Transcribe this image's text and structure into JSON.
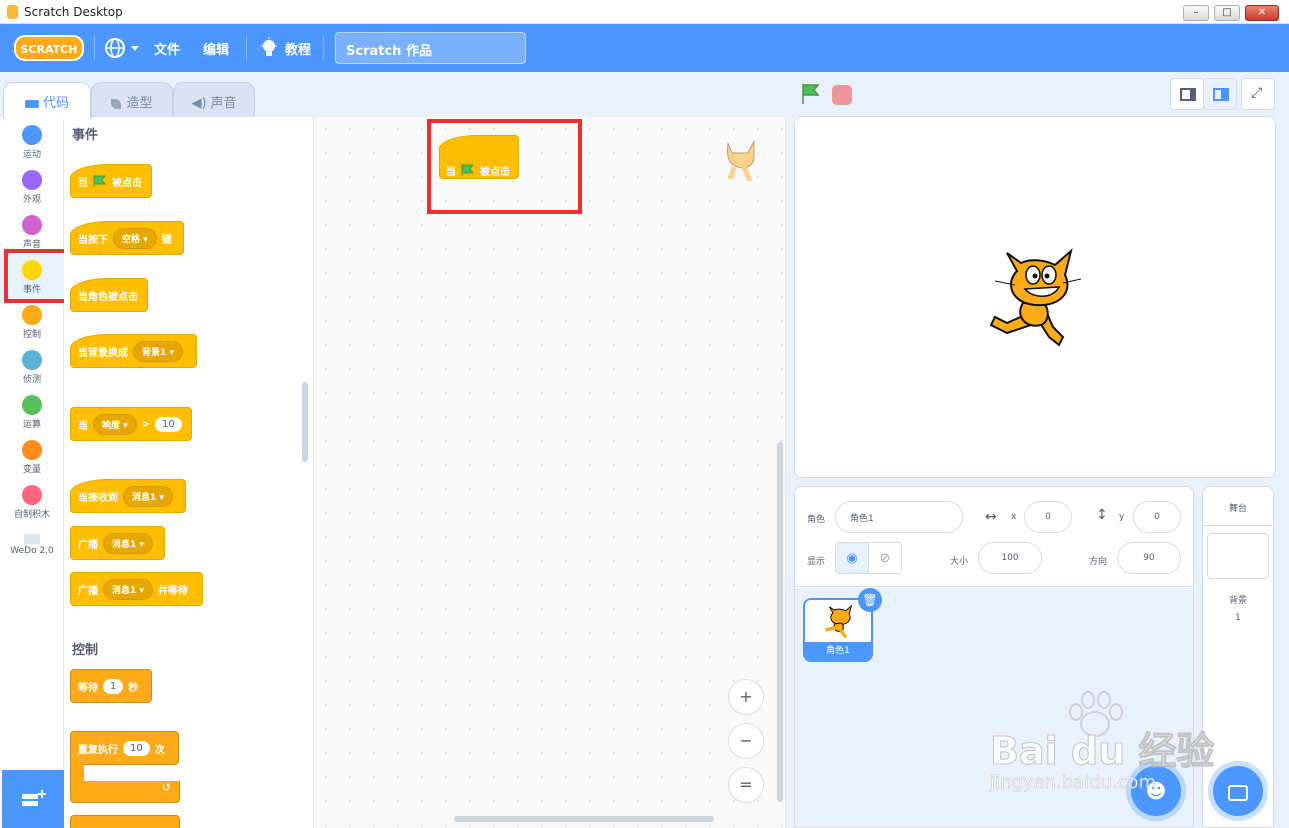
{
  "window": {
    "title": "Scratch Desktop",
    "buttons": [
      "–",
      "□",
      "✕"
    ]
  },
  "menubar": {
    "logo": "SCRATCH",
    "file": "文件",
    "edit": "编辑",
    "tutorials": "教程",
    "project_title": "Scratch 作品"
  },
  "tabs": [
    {
      "label": "代码"
    },
    {
      "label": "造型"
    },
    {
      "label": "声音"
    }
  ],
  "categories": [
    {
      "label": "运动",
      "color": "#4c97ff"
    },
    {
      "label": "外观",
      "color": "#9966ff"
    },
    {
      "label": "声音",
      "color": "#cf63cf"
    },
    {
      "label": "事件",
      "color": "#ffd500"
    },
    {
      "label": "控制",
      "color": "#ffab19"
    },
    {
      "label": "侦测",
      "color": "#5cb1d6"
    },
    {
      "label": "运算",
      "color": "#59c059"
    },
    {
      "label": "变量",
      "color": "#ff8c1a"
    },
    {
      "label": "自制积木",
      "color": "#ff6680"
    },
    {
      "label": "WeDo 2.0",
      "color": ""
    }
  ],
  "palette": {
    "events_header": "事件",
    "when_flag": {
      "pre": "当",
      "post": "被点击"
    },
    "when_key": {
      "pre": "当按下",
      "dropdown": "空格 ▾",
      "post": "键"
    },
    "when_sprite_clicked": "当角色被点击",
    "when_backdrop": {
      "pre": "当背景换成",
      "dropdown": "背景1 ▾"
    },
    "when_loudness": {
      "pre": "当",
      "dropdown": "响度 ▾",
      "op": ">",
      "value": "10"
    },
    "when_receive": {
      "pre": "当接收到",
      "dropdown": "消息1 ▾"
    },
    "broadcast": {
      "pre": "广播",
      "dropdown": "消息1 ▾"
    },
    "broadcast_wait": {
      "pre": "广播",
      "dropdown": "消息1 ▾",
      "post": "并等待"
    },
    "control_header": "控制",
    "wait": {
      "pre": "等待",
      "value": "1",
      "post": "秒"
    },
    "repeat": {
      "pre": "重复执行",
      "value": "10",
      "post": "次"
    }
  },
  "workspace": {
    "block": {
      "pre": "当",
      "post": "被点击"
    },
    "zoom_in": "+",
    "zoom_out": "−",
    "zoom_reset": "="
  },
  "sprite_info": {
    "sprite_label": "角色",
    "sprite_name": "角色1",
    "x_label": "x",
    "x": "0",
    "y_label": "y",
    "y": "0",
    "show_label": "显示",
    "size_label": "大小",
    "size": "100",
    "direction_label": "方向",
    "direction": "90"
  },
  "sprites": [
    {
      "name": "角色1"
    }
  ],
  "stage_panel": {
    "title": "舞台",
    "backdrops_label": "背景",
    "backdrops_count": "1"
  },
  "watermark": {
    "brand": "Bai du 经验",
    "url": "jingyan.baidu.com"
  }
}
